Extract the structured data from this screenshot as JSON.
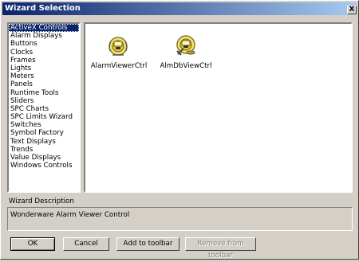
{
  "window": {
    "title": "Wizard Selection",
    "close_label": "X"
  },
  "categories": [
    {
      "label": "ActiveX Controls",
      "selected": true
    },
    {
      "label": "Alarm Displays"
    },
    {
      "label": "Buttons"
    },
    {
      "label": "Clocks"
    },
    {
      "label": "Frames"
    },
    {
      "label": "Lights"
    },
    {
      "label": "Meters"
    },
    {
      "label": "Panels"
    },
    {
      "label": "Runtime Tools"
    },
    {
      "label": "Sliders"
    },
    {
      "label": "SPC Charts"
    },
    {
      "label": "SPC Limits Wizard"
    },
    {
      "label": "Switches"
    },
    {
      "label": "Symbol Factory"
    },
    {
      "label": "Text Displays"
    },
    {
      "label": "Trends"
    },
    {
      "label": "Value Displays"
    },
    {
      "label": "Windows Controls"
    }
  ],
  "wizards": [
    {
      "label": "AlarmViewerCtrl",
      "icon": "alarm-viewer-icon"
    },
    {
      "label": "AlmDbViewCtrl",
      "icon": "alarm-db-view-icon"
    }
  ],
  "description": {
    "label": "Wizard Description",
    "text": "Wonderware Alarm Viewer Control"
  },
  "buttons": {
    "ok": "OK",
    "cancel": "Cancel",
    "add_to_toolbar": "Add to toolbar",
    "remove_from_toolbar": "Remove from  toolbar"
  }
}
